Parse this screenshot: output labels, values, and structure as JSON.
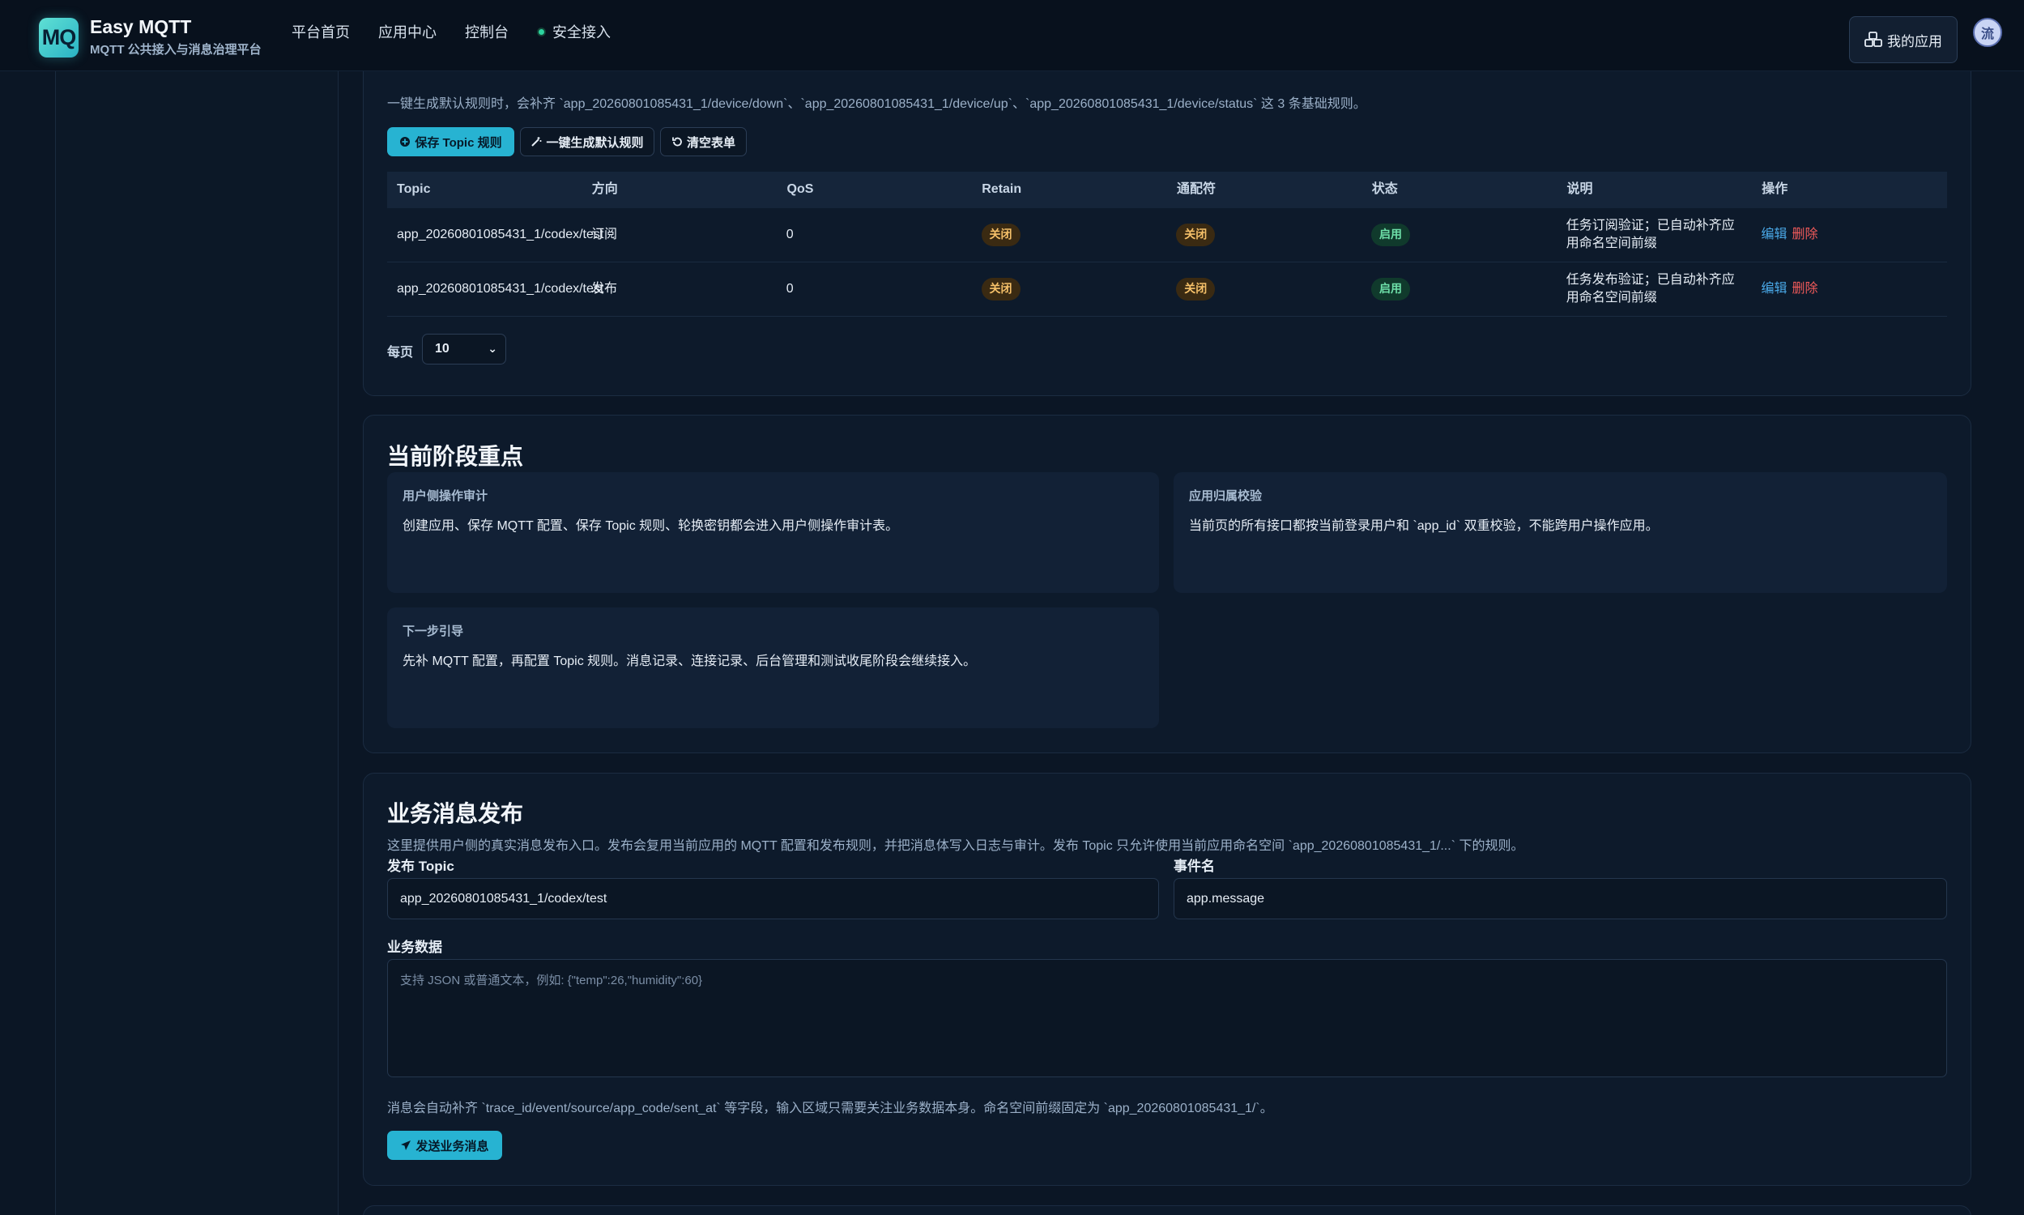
{
  "header": {
    "logo": "MQ",
    "title": "Easy MQTT",
    "subtitle": "MQTT 公共接入与消息治理平台",
    "nav": [
      "平台首页",
      "应用中心",
      "控制台",
      "安全接入"
    ],
    "my_apps": "我的应用",
    "avatar": "流"
  },
  "topic_rules": {
    "hint": "一键生成默认规则时，会补齐 `app_20260801085431_1/device/down`、`app_20260801085431_1/device/up`、`app_20260801085431_1/device/status` 这 3 条基础规则。",
    "save_btn": "保存 Topic 规则",
    "gen_btn": "一键生成默认规则",
    "clear_btn": "清空表单",
    "columns": [
      "Topic",
      "方向",
      "QoS",
      "Retain",
      "通配符",
      "状态",
      "说明",
      "操作"
    ],
    "rows": [
      {
        "topic": "app_20260801085431_1/codex/test",
        "direction": "订阅",
        "qos": "0",
        "retain": "关闭",
        "wildcard": "关闭",
        "status": "启用",
        "desc": "任务订阅验证；已自动补齐应用命名空间前缀",
        "edit": "编辑",
        "delete": "删除"
      },
      {
        "topic": "app_20260801085431_1/codex/test",
        "direction": "发布",
        "qos": "0",
        "retain": "关闭",
        "wildcard": "关闭",
        "status": "启用",
        "desc": "任务发布验证；已自动补齐应用命名空间前缀",
        "edit": "编辑",
        "delete": "删除"
      }
    ],
    "per_page_label": "每页",
    "per_page_value": "10"
  },
  "focus": {
    "title": "当前阶段重点",
    "cards": [
      {
        "title": "用户侧操作审计",
        "body": "创建应用、保存 MQTT 配置、保存 Topic 规则、轮换密钥都会进入用户侧操作审计表。"
      },
      {
        "title": "应用归属校验",
        "body": "当前页的所有接口都按当前登录用户和 `app_id` 双重校验，不能跨用户操作应用。"
      },
      {
        "title": "下一步引导",
        "body": "先补 MQTT 配置，再配置 Topic 规则。消息记录、连接记录、后台管理和测试收尾阶段会继续接入。"
      }
    ]
  },
  "publish": {
    "title": "业务消息发布",
    "desc": "这里提供用户侧的真实消息发布入口。发布会复用当前应用的 MQTT 配置和发布规则，并把消息体写入日志与审计。发布 Topic 只允许使用当前应用命名空间 `app_20260801085431_1/...` 下的规则。",
    "topic_label": "发布 Topic",
    "topic_value": "app_20260801085431_1/codex/test",
    "event_label": "事件名",
    "event_value": "app.message",
    "data_label": "业务数据",
    "data_placeholder": "支持 JSON 或普通文本，例如: {\"temp\":26,\"humidity\":60}",
    "note": "消息会自动补齐 `trace_id/event/source/app_code/sent_at` 等字段，输入区域只需要关注业务数据本身。命名空间前缀固定为 `app_20260801085431_1/`。",
    "send_btn": "发送业务消息"
  },
  "colors": {
    "accent": "#27b3d2",
    "badge_off": "#f5c069",
    "badge_on": "#6ee0a9",
    "danger": "#f05a5a"
  }
}
